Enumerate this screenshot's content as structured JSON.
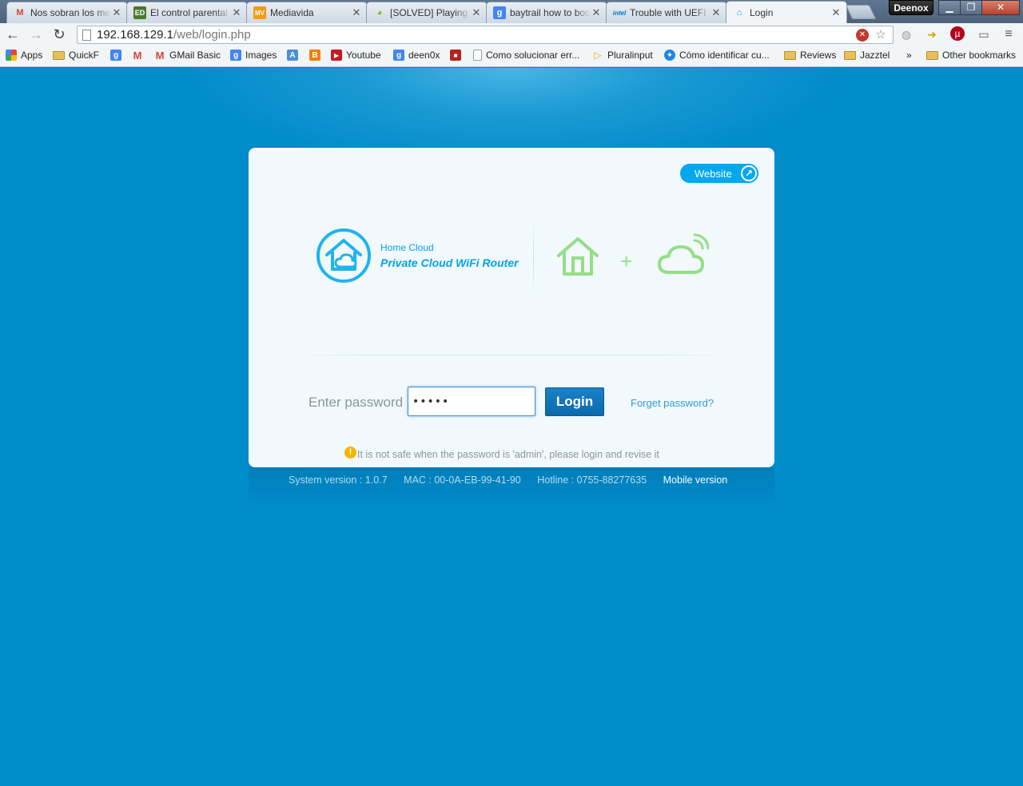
{
  "browser": {
    "tabs": [
      {
        "title": "Nos sobran los medios",
        "favicon": "gmail-icon",
        "color": "#d44638"
      },
      {
        "title": "El control parental",
        "favicon": "ed-icon",
        "color": "#4a7a2a"
      },
      {
        "title": "Mediavida",
        "favicon": "mv-icon",
        "color": "#f39c12"
      },
      {
        "title": "[SOLVED] Playing",
        "favicon": "nvidia-icon",
        "color": "#76b900"
      },
      {
        "title": "baytrail how to boot",
        "favicon": "google-icon",
        "color": "#4285f4"
      },
      {
        "title": "Trouble with UEFI",
        "favicon": "intel-icon",
        "color": "#0071c5"
      },
      {
        "title": "Login",
        "favicon": "home-cloud-icon",
        "color": "#00a8ee"
      }
    ],
    "user": "Deenox",
    "url_host": "192.168.129.1",
    "url_path": "/web/login.php",
    "bookmarks": [
      {
        "label": "Apps",
        "type": "apps"
      },
      {
        "label": "QuickF",
        "type": "folder"
      },
      {
        "label": "",
        "type": "google"
      },
      {
        "label": "",
        "type": "gmail"
      },
      {
        "label": "GMail Basic",
        "type": "gmail"
      },
      {
        "label": "Images",
        "type": "google"
      },
      {
        "label": "",
        "type": "translate"
      },
      {
        "label": "",
        "type": "blogger"
      },
      {
        "label": "Youtube",
        "type": "youtube"
      },
      {
        "label": "deen0x",
        "type": "google"
      },
      {
        "label": "",
        "type": "red"
      },
      {
        "label": "Como solucionar err...",
        "type": "page"
      },
      {
        "label": "Pluralinput",
        "type": "play"
      },
      {
        "label": "Cómo identificar cu...",
        "type": "blue"
      },
      {
        "label": "Reviews",
        "type": "folder"
      },
      {
        "label": "Jazztel",
        "type": "folder"
      },
      {
        "label": "»",
        "type": "more"
      },
      {
        "label": "Other bookmarks",
        "type": "folder"
      }
    ]
  },
  "page": {
    "website_label": "Website",
    "brand_sub": "Home Cloud",
    "brand_title": "Private Cloud WiFi Router",
    "password_label": "Enter password",
    "password_value": "admin",
    "login_label": "Login",
    "forgot_label": "Forget password?",
    "warning": "It is not safe when the password is 'admin', please login and revise it",
    "footer": {
      "system_version": "System version : 1.0.7",
      "mac": "MAC : 00-0A-EB-99-41-90",
      "hotline": "Hotline : 0755-88277635",
      "mobile": "Mobile version"
    },
    "colors": {
      "accent": "#00a8ee",
      "background": "#008bc9",
      "icon_green": "#95dd86"
    }
  }
}
